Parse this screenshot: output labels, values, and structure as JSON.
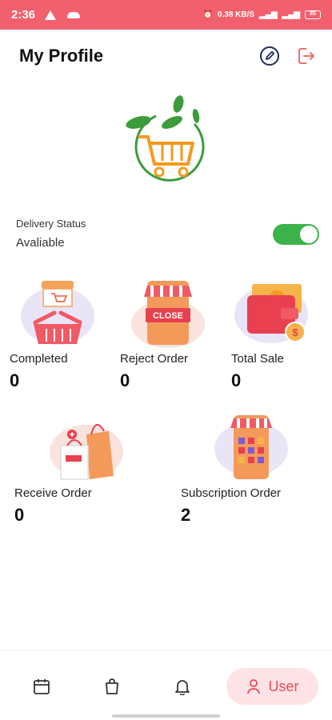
{
  "status_bar": {
    "time": "2:36",
    "battery": "85",
    "network_label": "0.38 KB/S"
  },
  "header": {
    "title": "My Profile"
  },
  "delivery": {
    "label": "Delivery Status",
    "value": "Avaliable",
    "toggle_on": true
  },
  "stats": [
    {
      "label": "Completed",
      "value": "0",
      "icon": "shopping-cart-basket-icon"
    },
    {
      "label": "Reject Order",
      "value": "0",
      "icon": "closed-shop-icon",
      "badge": "CLOSE"
    },
    {
      "label": "Total Sale",
      "value": "0",
      "icon": "wallet-money-icon"
    },
    {
      "label": "Receive Order",
      "value": "0",
      "icon": "shopping-bags-icon"
    },
    {
      "label": "Subscription Order",
      "value": "2",
      "icon": "mobile-shop-icon"
    }
  ],
  "nav": {
    "active_label": "User"
  },
  "colors": {
    "accent": "#e84a5a",
    "status_bar": "#f2606e",
    "toggle": "#3cb34a",
    "logo_green": "#3a9d3a",
    "logo_orange": "#f39a1f"
  }
}
